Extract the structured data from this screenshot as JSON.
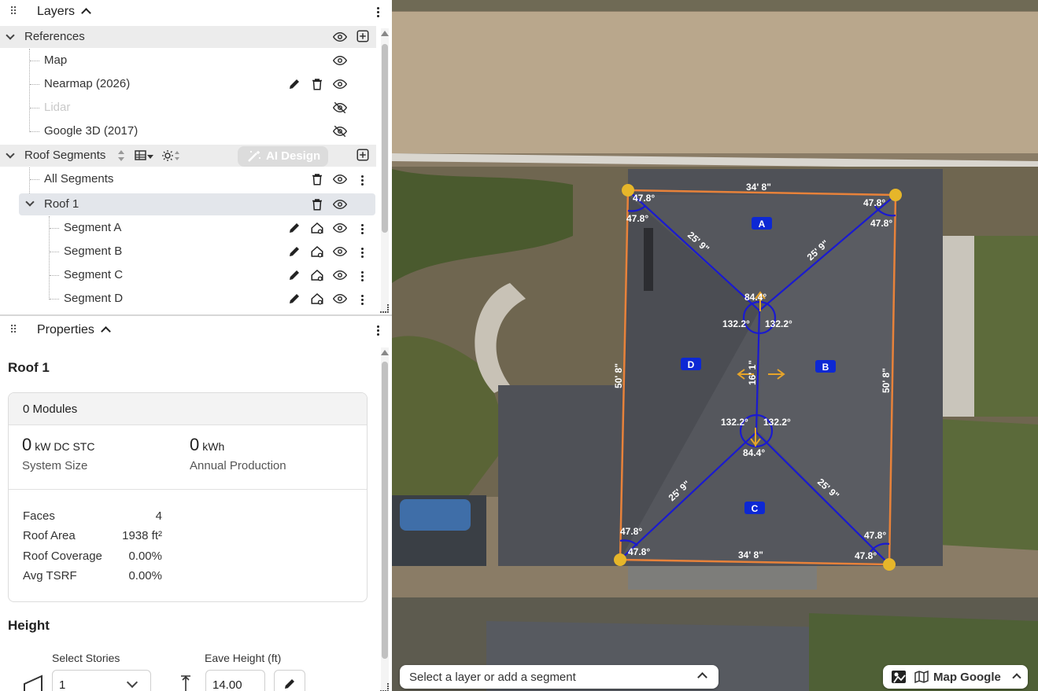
{
  "layers_panel": {
    "title": "Layers",
    "references": {
      "label": "References",
      "items": [
        {
          "label": "Map",
          "hidden": false
        },
        {
          "label": "Nearmap (2026)",
          "hidden": false
        },
        {
          "label": "Lidar",
          "hidden": true
        },
        {
          "label": "Google 3D (2017)",
          "hidden": true
        }
      ]
    },
    "roof_segments": {
      "label": "Roof Segments",
      "ai_design_label": "AI Design",
      "all_segments_label": "All Segments",
      "roof": {
        "label": "Roof 1",
        "segments": [
          "Segment A",
          "Segment B",
          "Segment C",
          "Segment D"
        ]
      }
    }
  },
  "properties_panel": {
    "title": "Properties",
    "roof_name": "Roof 1",
    "modules_header": "0 Modules",
    "system_size": {
      "value": "0",
      "unit": "kW DC STC",
      "label": "System Size"
    },
    "annual_production": {
      "value": "0",
      "unit": "kWh",
      "label": "Annual Production"
    },
    "stats": [
      {
        "key": "Faces",
        "value": "4"
      },
      {
        "key": "Roof Area",
        "value": "1938 ft²"
      },
      {
        "key": "Roof Coverage",
        "value": "0.00%"
      },
      {
        "key": "Avg TSRF",
        "value": "0.00%"
      }
    ],
    "height": {
      "title": "Height",
      "stories_label": "Select Stories",
      "stories_value": "1",
      "eave_label": "Eave Height (ft)",
      "eave_value": "14.00"
    }
  },
  "map": {
    "prompt": "Select a layer or add a segment",
    "map_source_label": "Map Google",
    "edge_labels": {
      "top": "34' 8\"",
      "bottom": "34' 8\"",
      "left": "50' 8\"",
      "right": "50' 8\"",
      "ridge": "16' 1\""
    },
    "hip_labels": [
      "25' 9\"",
      "25' 9\"",
      "25' 9\"",
      "25' 9\""
    ],
    "corner_angle": "47.8°",
    "apex_angle": "84.4°",
    "side_angle": "132.2°",
    "face_labels": [
      "A",
      "B",
      "C",
      "D"
    ],
    "colors": {
      "outline": "#e8823a",
      "lines": "#1a1ad0",
      "vertex": "#e6b62a",
      "face_tag": "#0d28d4"
    }
  }
}
